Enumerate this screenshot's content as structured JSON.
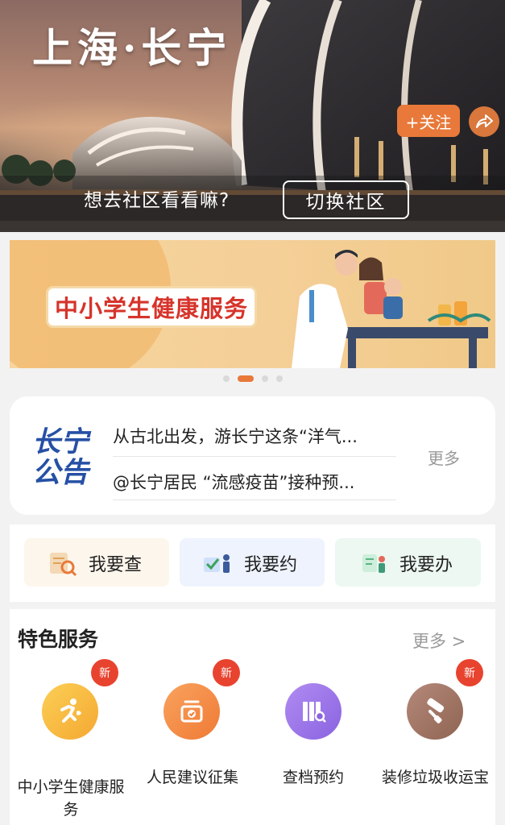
{
  "hero": {
    "title": "上海·长宁",
    "follow_label": "+关注",
    "share_icon": "share-arrow-icon",
    "prompt_text": "想去社区看看嘛?",
    "switch_label": "切换社区"
  },
  "banner": {
    "title": "中小学生健康服务",
    "slide_count": 4,
    "active_slide": 2
  },
  "notice": {
    "logo_line1": "长宁",
    "logo_line2": "公告",
    "items": [
      "从古北出发，游长宁这条“洋气...",
      "@长宁居民 “流感疫苗”接种预..."
    ],
    "more_label": "更多"
  },
  "quick_actions": [
    {
      "label": "我要查",
      "icon": "search-document-icon"
    },
    {
      "label": "我要约",
      "icon": "appointment-check-icon"
    },
    {
      "label": "我要办",
      "icon": "service-handling-icon"
    }
  ],
  "featured": {
    "title": "特色服务",
    "more_label": "更多 >",
    "badge_label": "新",
    "items": [
      {
        "label_line1": "中小学生健康服",
        "label_line2": "务",
        "icon": "running-person-icon",
        "color": "#f5a832",
        "is_new": true
      },
      {
        "label_line1": "人民建议征集",
        "label_line2": "",
        "icon": "suggestion-box-icon",
        "color": "#ef7a35",
        "is_new": true
      },
      {
        "label_line1": "查档预约",
        "label_line2": "",
        "icon": "archive-search-icon",
        "color": "#8a63e0",
        "is_new": false
      },
      {
        "label_line1": "装修垃圾收运宝",
        "label_line2": "",
        "icon": "paint-roller-icon",
        "color": "#9a6b55",
        "is_new": true
      }
    ]
  },
  "colors": {
    "accent": "#e8793a",
    "badge": "#e8432e",
    "notice_logo": "#2650a5"
  }
}
